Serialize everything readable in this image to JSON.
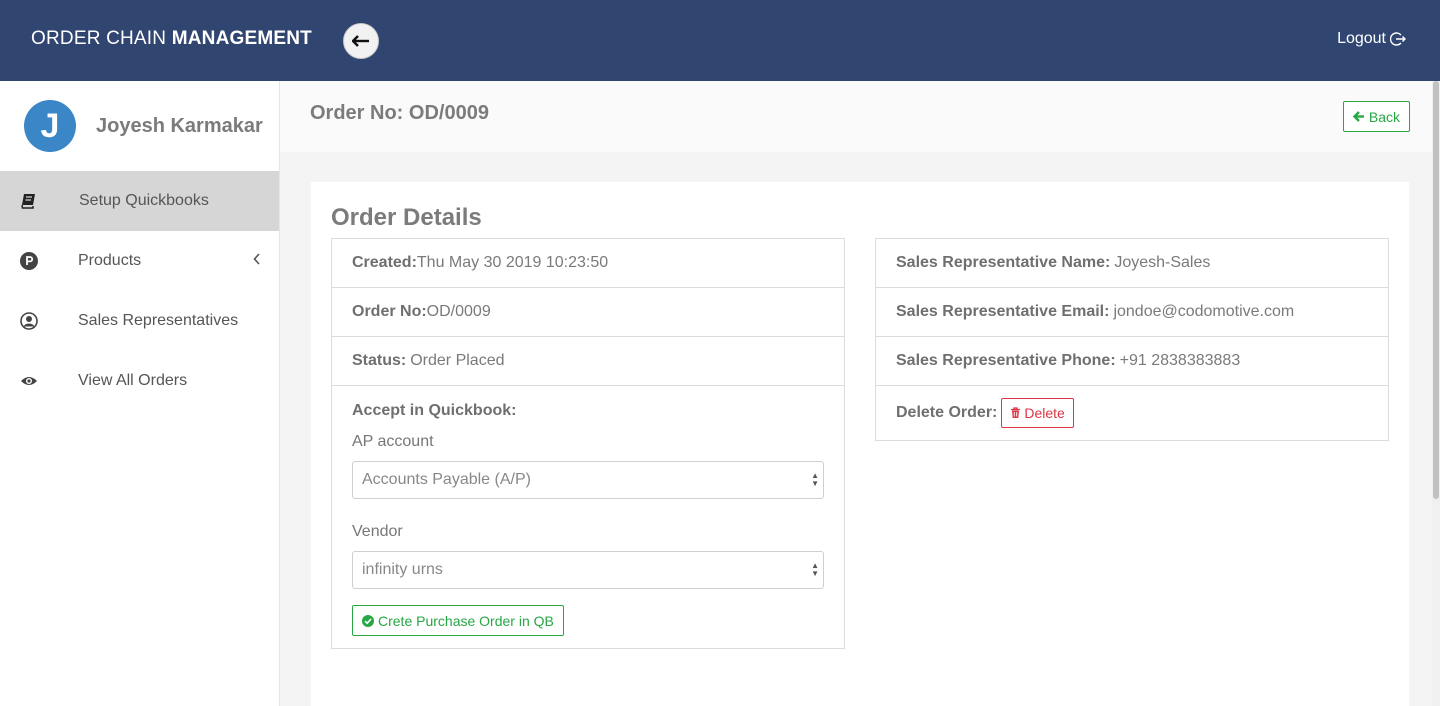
{
  "header": {
    "brand_light": "ORDER CHAIN",
    "brand_bold": "MANAGEMENT",
    "logout_label": "Logout",
    "bg_color": "#304570"
  },
  "sidebar": {
    "avatar_letter": "J",
    "user_name": "Joyesh Karmakar",
    "items": [
      {
        "label": "Setup Quickbooks",
        "icon": "book-icon",
        "active": true
      },
      {
        "label": "Products",
        "icon": "p-circle-icon",
        "has_submenu": true
      },
      {
        "label": "Sales Representatives",
        "icon": "user-circle-icon"
      },
      {
        "label": "View All Orders",
        "icon": "eye-icon"
      }
    ]
  },
  "page": {
    "order_title": "Order No: OD/0009",
    "back_label": "Back"
  },
  "details": {
    "title": "Order Details",
    "created_label": "Created:",
    "created_value": "Thu May 30 2019 10:23:50",
    "order_no_label": "Order No:",
    "order_no_value": "OD/0009",
    "status_label": "Status:",
    "status_value": "Order Placed",
    "accept_title": "Accept in Quickbook:",
    "ap_account_label": "AP account",
    "ap_account_value": "Accounts Payable (A/P)",
    "vendor_label": "Vendor",
    "vendor_value": "infinity urns",
    "create_po_label": "Crete Purchase Order in QB"
  },
  "sales_rep": {
    "name_label": "Sales Representative Name:",
    "name_value": "Joyesh-Sales",
    "email_label": "Sales Representative Email:",
    "email_value": "jondoe@codomotive.com",
    "phone_label": "Sales Representative Phone:",
    "phone_value": "+91 2838383883",
    "delete_label": "Delete Order:",
    "delete_button": "Delete"
  },
  "colors": {
    "success": "#28a745",
    "danger": "#dc3545",
    "avatar": "#3a86c6"
  }
}
